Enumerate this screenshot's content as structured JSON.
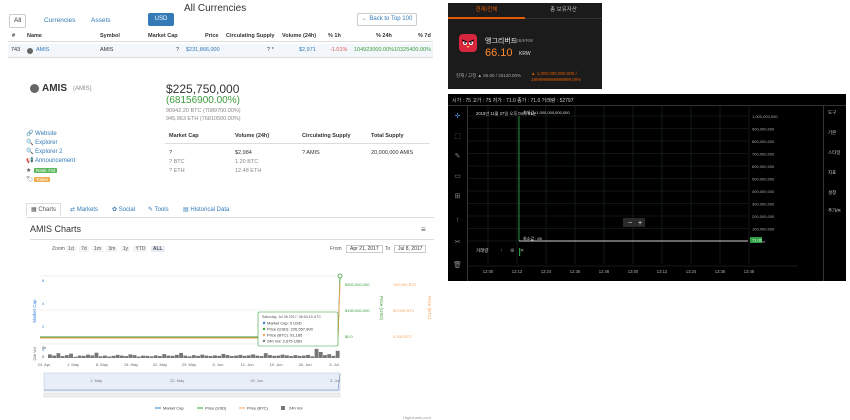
{
  "currencies": {
    "title": "All Currencies",
    "tabs": {
      "all": "All",
      "currencies": "Currencies",
      "assets": "Assets"
    },
    "currency_select": "USD",
    "back_label": "← Back to Top 100",
    "columns": [
      "#",
      "Name",
      "Symbol",
      "Market Cap",
      "Price",
      "Circulating Supply",
      "Volume (24h)",
      "% 1h",
      "% 24h",
      "% 7d"
    ],
    "row": {
      "rank": "743",
      "name": "AMIS",
      "symbol": "AMIS",
      "market_cap": "?",
      "price": "$231,866,000",
      "supply": "? *",
      "volume": "$2,971",
      "change_1h": "-1.01%",
      "change_24h": "104923000.00%",
      "change_7d": "10325400.00%"
    }
  },
  "detail": {
    "name": "AMIS",
    "symbol": "(AMIS)",
    "price_usd": "$225,750,000",
    "change": "(68156900.00%)",
    "price_btc": "90942.20 BTC (7089700.00%)",
    "price_eth": "945,963 ETH (76810500.00%)",
    "links": [
      "Website",
      "Explorer",
      "Explorer 2",
      "Announcement"
    ],
    "tags": [
      "Rank 743",
      "Token"
    ],
    "tag_colors": [
      "#5cb85c",
      "#f0ad4e"
    ],
    "stats": {
      "headers": [
        "Market Cap",
        "Volume (24h)",
        "Circulating Supply",
        "Total Supply"
      ],
      "market_cap": [
        "?",
        "? BTC",
        "? ETH"
      ],
      "volume": [
        "$2,984",
        "1.20 BTC",
        "12.48 ETH"
      ],
      "supply": "? AMIS",
      "total_supply": "20,000,000 AMIS"
    },
    "tabs": [
      "Charts",
      "Markets",
      "Social",
      "Tools",
      "Historical Data"
    ]
  },
  "chart": {
    "title": "AMIS Charts",
    "zoom_label": "Zoom",
    "zoom_options": [
      "1d",
      "7d",
      "1m",
      "3m",
      "1y",
      "YTD",
      "ALL"
    ],
    "zoom_active": "ALL",
    "from_label": "From",
    "from_date": "Apr 21, 2017",
    "to_label": "To",
    "to_date": "Jul 8, 2017",
    "tooltip": {
      "date": "Saturday, Jul 08 2017, 06:54:15 UTC",
      "market_cap": "Market Cap: 0 USD",
      "price_usd": "Price (USD): 226,557,900",
      "price_btc": "Price (BTC): 91,185",
      "volume": "24h Vol: 2,975 USD"
    },
    "legend": [
      "Market Cap",
      "Price (USD)",
      "Price (BTC)",
      "24h Vol"
    ],
    "credits": "Highcharts.com",
    "colors": {
      "market_cap": "#2f7ed8",
      "price_usd": "#3c9d3c",
      "price_btc": "#f7a35c",
      "volume": "#777777"
    }
  },
  "chart_data": {
    "type": "line",
    "title": "AMIS Charts",
    "x_ticks": [
      "24. Apr",
      "1. May",
      "8. May",
      "15. May",
      "22. May",
      "29. May",
      "5. Jun",
      "12. Jun",
      "19. Jun",
      "26. Jun",
      "3. Jul"
    ],
    "nav_ticks": [
      "1. May",
      "22. May",
      "19. Jun",
      "3. Jul"
    ],
    "y_left_label": "Market Cap",
    "y_left_ticks": [
      "6",
      "4",
      "2",
      "0"
    ],
    "y_price_usd_ticks": [
      "$300,000,000",
      "$150,000,000",
      "$0.0"
    ],
    "y_price_btc_ticks": [
      "100,000 BTC",
      "50,000 BTC",
      "0.000 BTC"
    ],
    "y_price_usd_label": "Price (USD)",
    "y_price_btc_label": "Price (BTC)",
    "y_vol_label": "24h Vol",
    "y_vol_ticks": [
      "5k",
      "0"
    ],
    "series": [
      {
        "name": "Price (USD)",
        "points": [
          [
            "24. Apr",
            0
          ],
          [
            "3. Jul",
            0
          ],
          [
            "8. Jul",
            226557900
          ]
        ]
      },
      {
        "name": "Price (BTC)",
        "points": [
          [
            "24. Apr",
            0
          ],
          [
            "3. Jul",
            0
          ],
          [
            "8. Jul",
            91185
          ]
        ]
      },
      {
        "name": "24h Vol",
        "values": [
          1.5,
          1.0,
          2.0,
          0.8,
          1.2,
          1.8,
          0.5,
          1.0,
          0.9,
          1.4,
          1.1,
          2.2,
          0.7,
          1.0,
          0.6,
          0.9,
          1.3,
          1.0,
          0.8,
          1.5,
          1.2,
          0.6,
          1.0,
          0.9,
          0.7,
          1.1,
          0.8,
          1.6,
          1.0,
          0.9,
          1.3,
          2.1,
          1.0,
          0.7,
          1.2,
          0.9,
          1.4,
          1.0,
          0.8,
          1.1,
          0.9,
          1.7,
          1.2,
          0.8,
          1.0,
          1.3,
          0.9,
          1.1,
          1.5,
          1.0,
          0.8,
          2.0,
          1.2,
          0.9,
          1.0,
          1.4,
          1.1,
          0.8,
          1.2,
          0.9,
          1.0,
          1.3,
          0.7,
          3.8,
          2.5,
          1.2,
          1.6,
          0.9,
          3.0
        ]
      }
    ]
  },
  "kr_exchange": {
    "tab_active": "현재/전체",
    "tab_other": "총 보유자산",
    "coin_name": "앵그리버드",
    "pair": "AGB/KRW",
    "price": "66.10",
    "unit": "KRW",
    "stat_left": "현재 / 고정  ▲ 65.60 / 33120.00%",
    "stat_right": "▲ 1,000,000,000,000 / 1999999999999999.00%"
  },
  "trading": {
    "header": "시가 : 75   고가 : 75   저가 : 71.0   종가 : 71.0   거래량 : 52797",
    "info": "2018년 11월 27일 오후 04시 51분",
    "max_label": "최대값: 1,000,000,000,000",
    "min_label": "최소값 : 65",
    "volume_label": "거래량",
    "right_menu": [
      "도구",
      "기본",
      "스타일",
      "지표",
      "설정",
      "추가/R"
    ],
    "y_ticks": [
      "1,000,000,000",
      "900,000,000",
      "800,000,000",
      "700,000,000",
      "600,000,000",
      "500,000,000",
      "400,000,000",
      "300,000,000",
      "200,000,000",
      "100,000,000",
      "10.00m"
    ],
    "x_ticks": [
      "12:00",
      "12:12",
      "12:24",
      "12:36",
      "12:48",
      "13:00",
      "13:12",
      "13:24",
      "13:36",
      "13:48"
    ],
    "current_tag": "71.00",
    "zoom_minus": "−",
    "zoom_plus": "+"
  }
}
